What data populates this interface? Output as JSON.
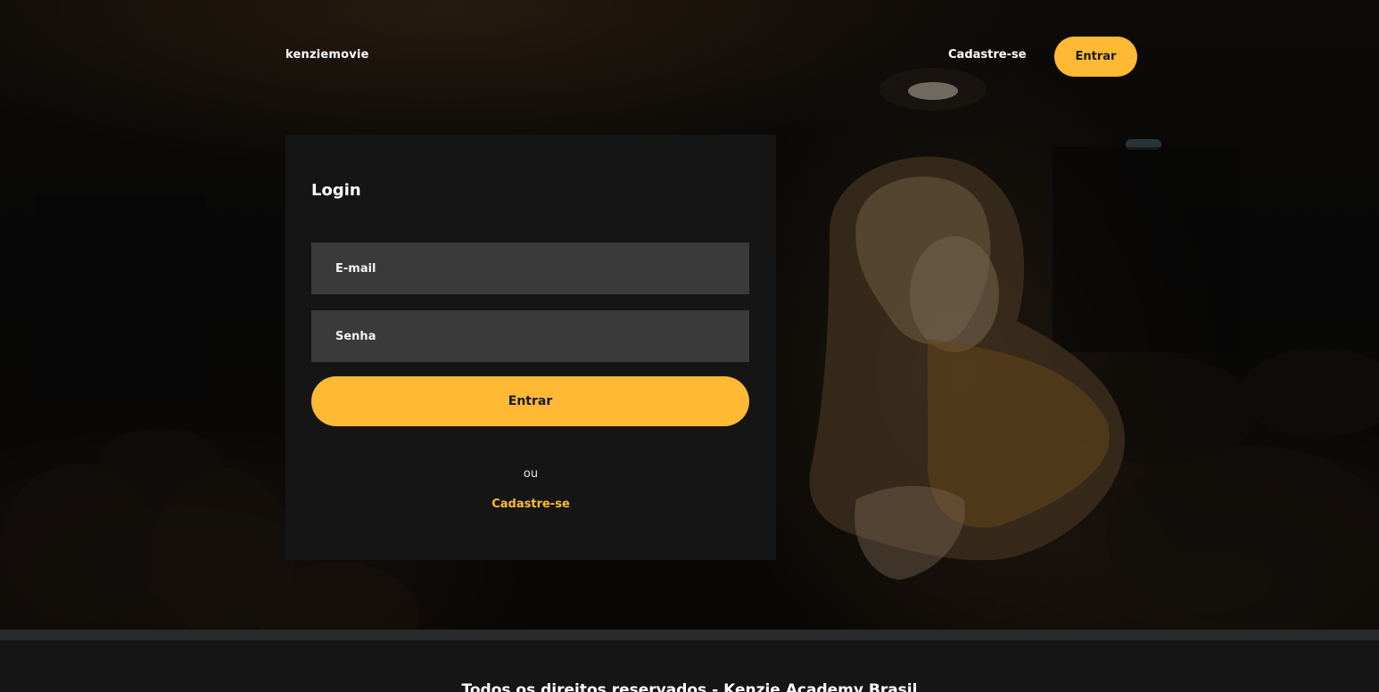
{
  "header": {
    "brand": "kenziemovie",
    "signup_link": "Cadastre-se",
    "login_button": "Entrar"
  },
  "login": {
    "title": "Login",
    "email_placeholder": "E-mail",
    "password_placeholder": "Senha",
    "submit_label": "Entrar",
    "or_text": "ou",
    "signup_link": "Cadastre-se"
  },
  "footer": {
    "text": "Todos os direitos reservados - Kenzie Academy Brasil"
  },
  "colors": {
    "accent": "#ffb935",
    "card_background": "#151515",
    "input_background": "#3a3a3a",
    "footer_background": "#161616"
  },
  "background": {
    "icon": "cinema-woman-photo"
  }
}
